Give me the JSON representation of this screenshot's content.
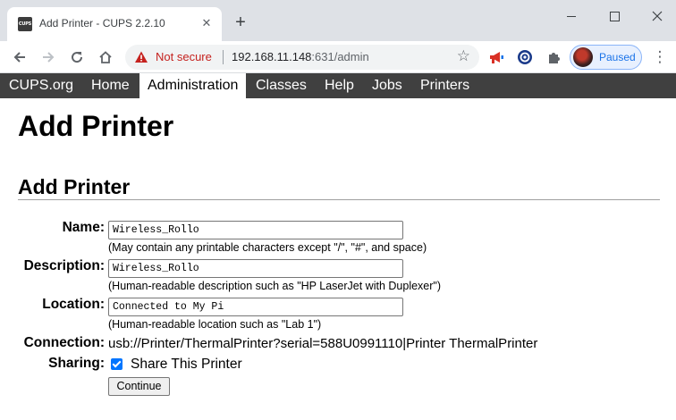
{
  "browser": {
    "tab_title": "Add Printer - CUPS 2.2.10",
    "tab_favicon_text": "CUPS",
    "tab_close": "✕",
    "new_tab": "+",
    "security_label": "Not secure",
    "url_host": "192.168.11.148",
    "url_rest": ":631/admin",
    "profile_status": "Paused"
  },
  "nav": {
    "items": [
      {
        "label": "CUPS.org"
      },
      {
        "label": "Home"
      },
      {
        "label": "Administration",
        "active": true
      },
      {
        "label": "Classes"
      },
      {
        "label": "Help"
      },
      {
        "label": "Jobs"
      },
      {
        "label": "Printers"
      }
    ]
  },
  "page": {
    "title": "Add Printer",
    "section_title": "Add Printer"
  },
  "form": {
    "name_label": "Name:",
    "name_value": "Wireless_Rollo",
    "name_hint": "(May contain any printable characters except \"/\", \"#\", and space)",
    "description_label": "Description:",
    "description_value": "Wireless_Rollo",
    "description_hint": "(Human-readable description such as \"HP LaserJet with Duplexer\")",
    "location_label": "Location:",
    "location_value": "Connected to My Pi",
    "location_hint": "(Human-readable location such as \"Lab 1\")",
    "connection_label": "Connection:",
    "connection_value": "usb://Printer/ThermalPrinter?serial=588U0991110|Printer ThermalPrinter",
    "sharing_label": "Sharing:",
    "sharing_checked": true,
    "sharing_text": "Share This Printer",
    "continue_label": "Continue"
  },
  "colors": {
    "nav_bg": "#404040",
    "not_secure": "#c5221f",
    "checkbox": "#0075ff"
  }
}
